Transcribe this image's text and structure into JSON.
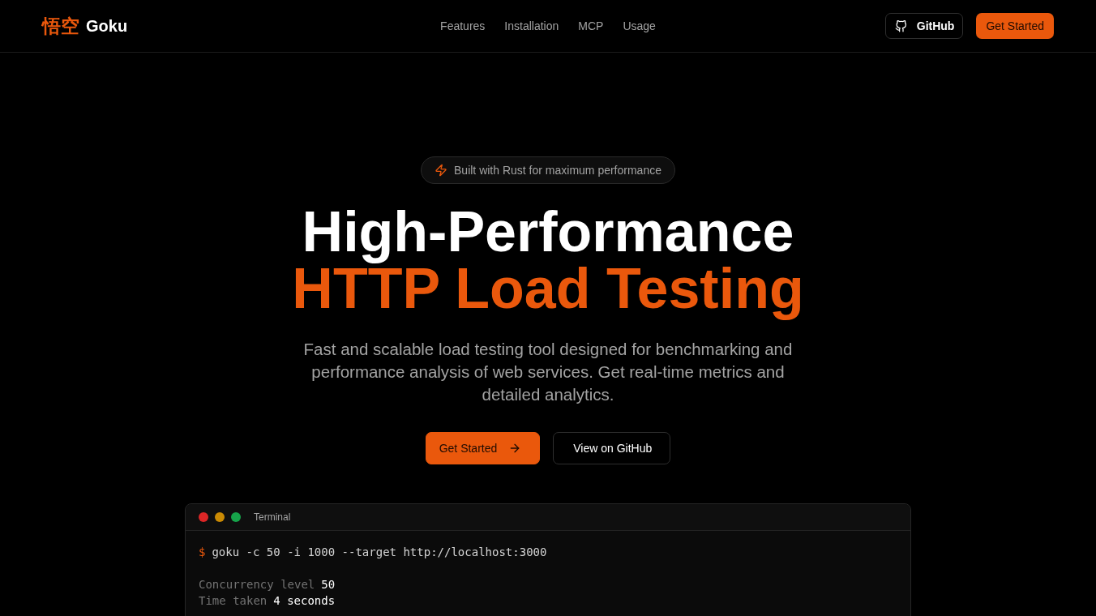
{
  "header": {
    "logo": {
      "mark": "悟空",
      "name": "Goku"
    },
    "nav": [
      "Features",
      "Installation",
      "MCP",
      "Usage"
    ],
    "github_button": "GitHub",
    "cta_button": "Get Started"
  },
  "hero": {
    "badge": "Built with Rust for maximum performance",
    "title_line_1": "High-Performance",
    "title_line_2": "HTTP Load Testing",
    "description": "Fast and scalable load testing tool designed for benchmarking and performance analysis of web services. Get real-time metrics and detailed analytics.",
    "buttons": [
      {
        "label": "Get Started",
        "kind": "primary"
      },
      {
        "label": "View on GitHub",
        "kind": "secondary"
      }
    ]
  },
  "terminal": {
    "title": "Terminal",
    "prompt": "$",
    "command": "goku -c 50 -i 1000 --target http://localhost:3000",
    "stats": [
      {
        "label": "Concurrency level",
        "value": "50"
      },
      {
        "label": "Time taken",
        "value": "4 seconds"
      }
    ]
  }
}
